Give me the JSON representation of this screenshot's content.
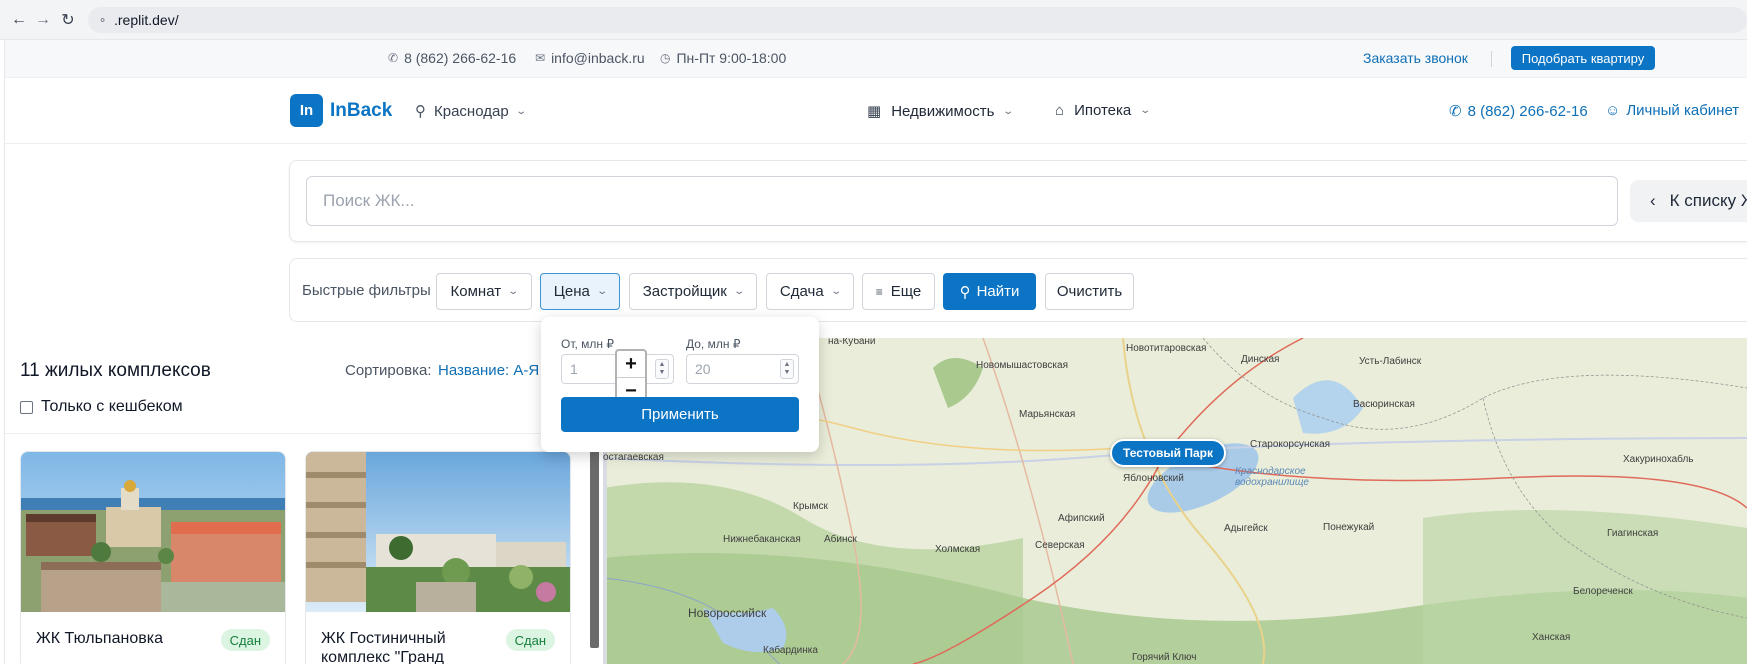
{
  "browser": {
    "url": ".replit.dev/"
  },
  "topbar": {
    "phone": "8 (862) 266-62-16",
    "email": "info@inback.ru",
    "hours": "Пн-Пт 9:00-18:00",
    "order_call": "Заказать звонок",
    "pick_apartment": "Подобрать квартиру"
  },
  "header": {
    "logo_mark": "In",
    "logo_text": "InBack",
    "city": "Краснодар",
    "menu": [
      {
        "label": "Недвижимость",
        "icon": "building-icon"
      },
      {
        "label": "Ипотека",
        "icon": "home-icon"
      }
    ],
    "phone": "8 (862) 266-62-16",
    "cabinet": "Личный кабинет"
  },
  "search": {
    "placeholder": "Поиск ЖК...",
    "back_to_list": "К списку Ж"
  },
  "filters": {
    "label": "Быстрые фильтры",
    "buttons": [
      "Комнат",
      "Цена",
      "Застройщик",
      "Сдача",
      "Еще"
    ],
    "find": "Найти",
    "clear": "Очистить"
  },
  "price_popup": {
    "from_label": "От, млн ₽",
    "from_placeholder": "1",
    "to_label": "До, млн ₽",
    "to_placeholder": "20",
    "apply": "Применить",
    "zoom_in": "+",
    "zoom_out": "−"
  },
  "list": {
    "count_title": "11 жилых комплексов",
    "sort_label": "Сортировка:",
    "sort_value": "Название: А-Я",
    "cashback_only": "Только с кешбеком",
    "cards": [
      {
        "name": "ЖК Тюльпановка",
        "status": "Сдан"
      },
      {
        "name": "ЖК Гостиничный комплекс \"Гранд",
        "status": "Сдан"
      }
    ]
  },
  "map": {
    "pin": "Тестовый Парк",
    "labels": [
      "на-Кубани",
      "Новомышастовская",
      "Новотитаровская",
      "Динская",
      "Усть-Лабинск",
      "Марьянская",
      "Васюринская",
      "остагаевская",
      "Старокорсунская",
      "Хакуринохабль",
      "Яблоновский",
      "Краснодарское водохранилище",
      "Крымск",
      "Афипский",
      "Адыгейск",
      "Понежукай",
      "Нижнебаканская",
      "Абинск",
      "Холмская",
      "Северская",
      "Гиагинская",
      "Новороссийск",
      "Белореченск",
      "Кабардинка",
      "Ханская",
      "Горячий Ключ"
    ]
  },
  "colors": {
    "accent": "#0b74c4",
    "badge_bg": "#dcf5e3",
    "badge_text": "#15803d"
  }
}
